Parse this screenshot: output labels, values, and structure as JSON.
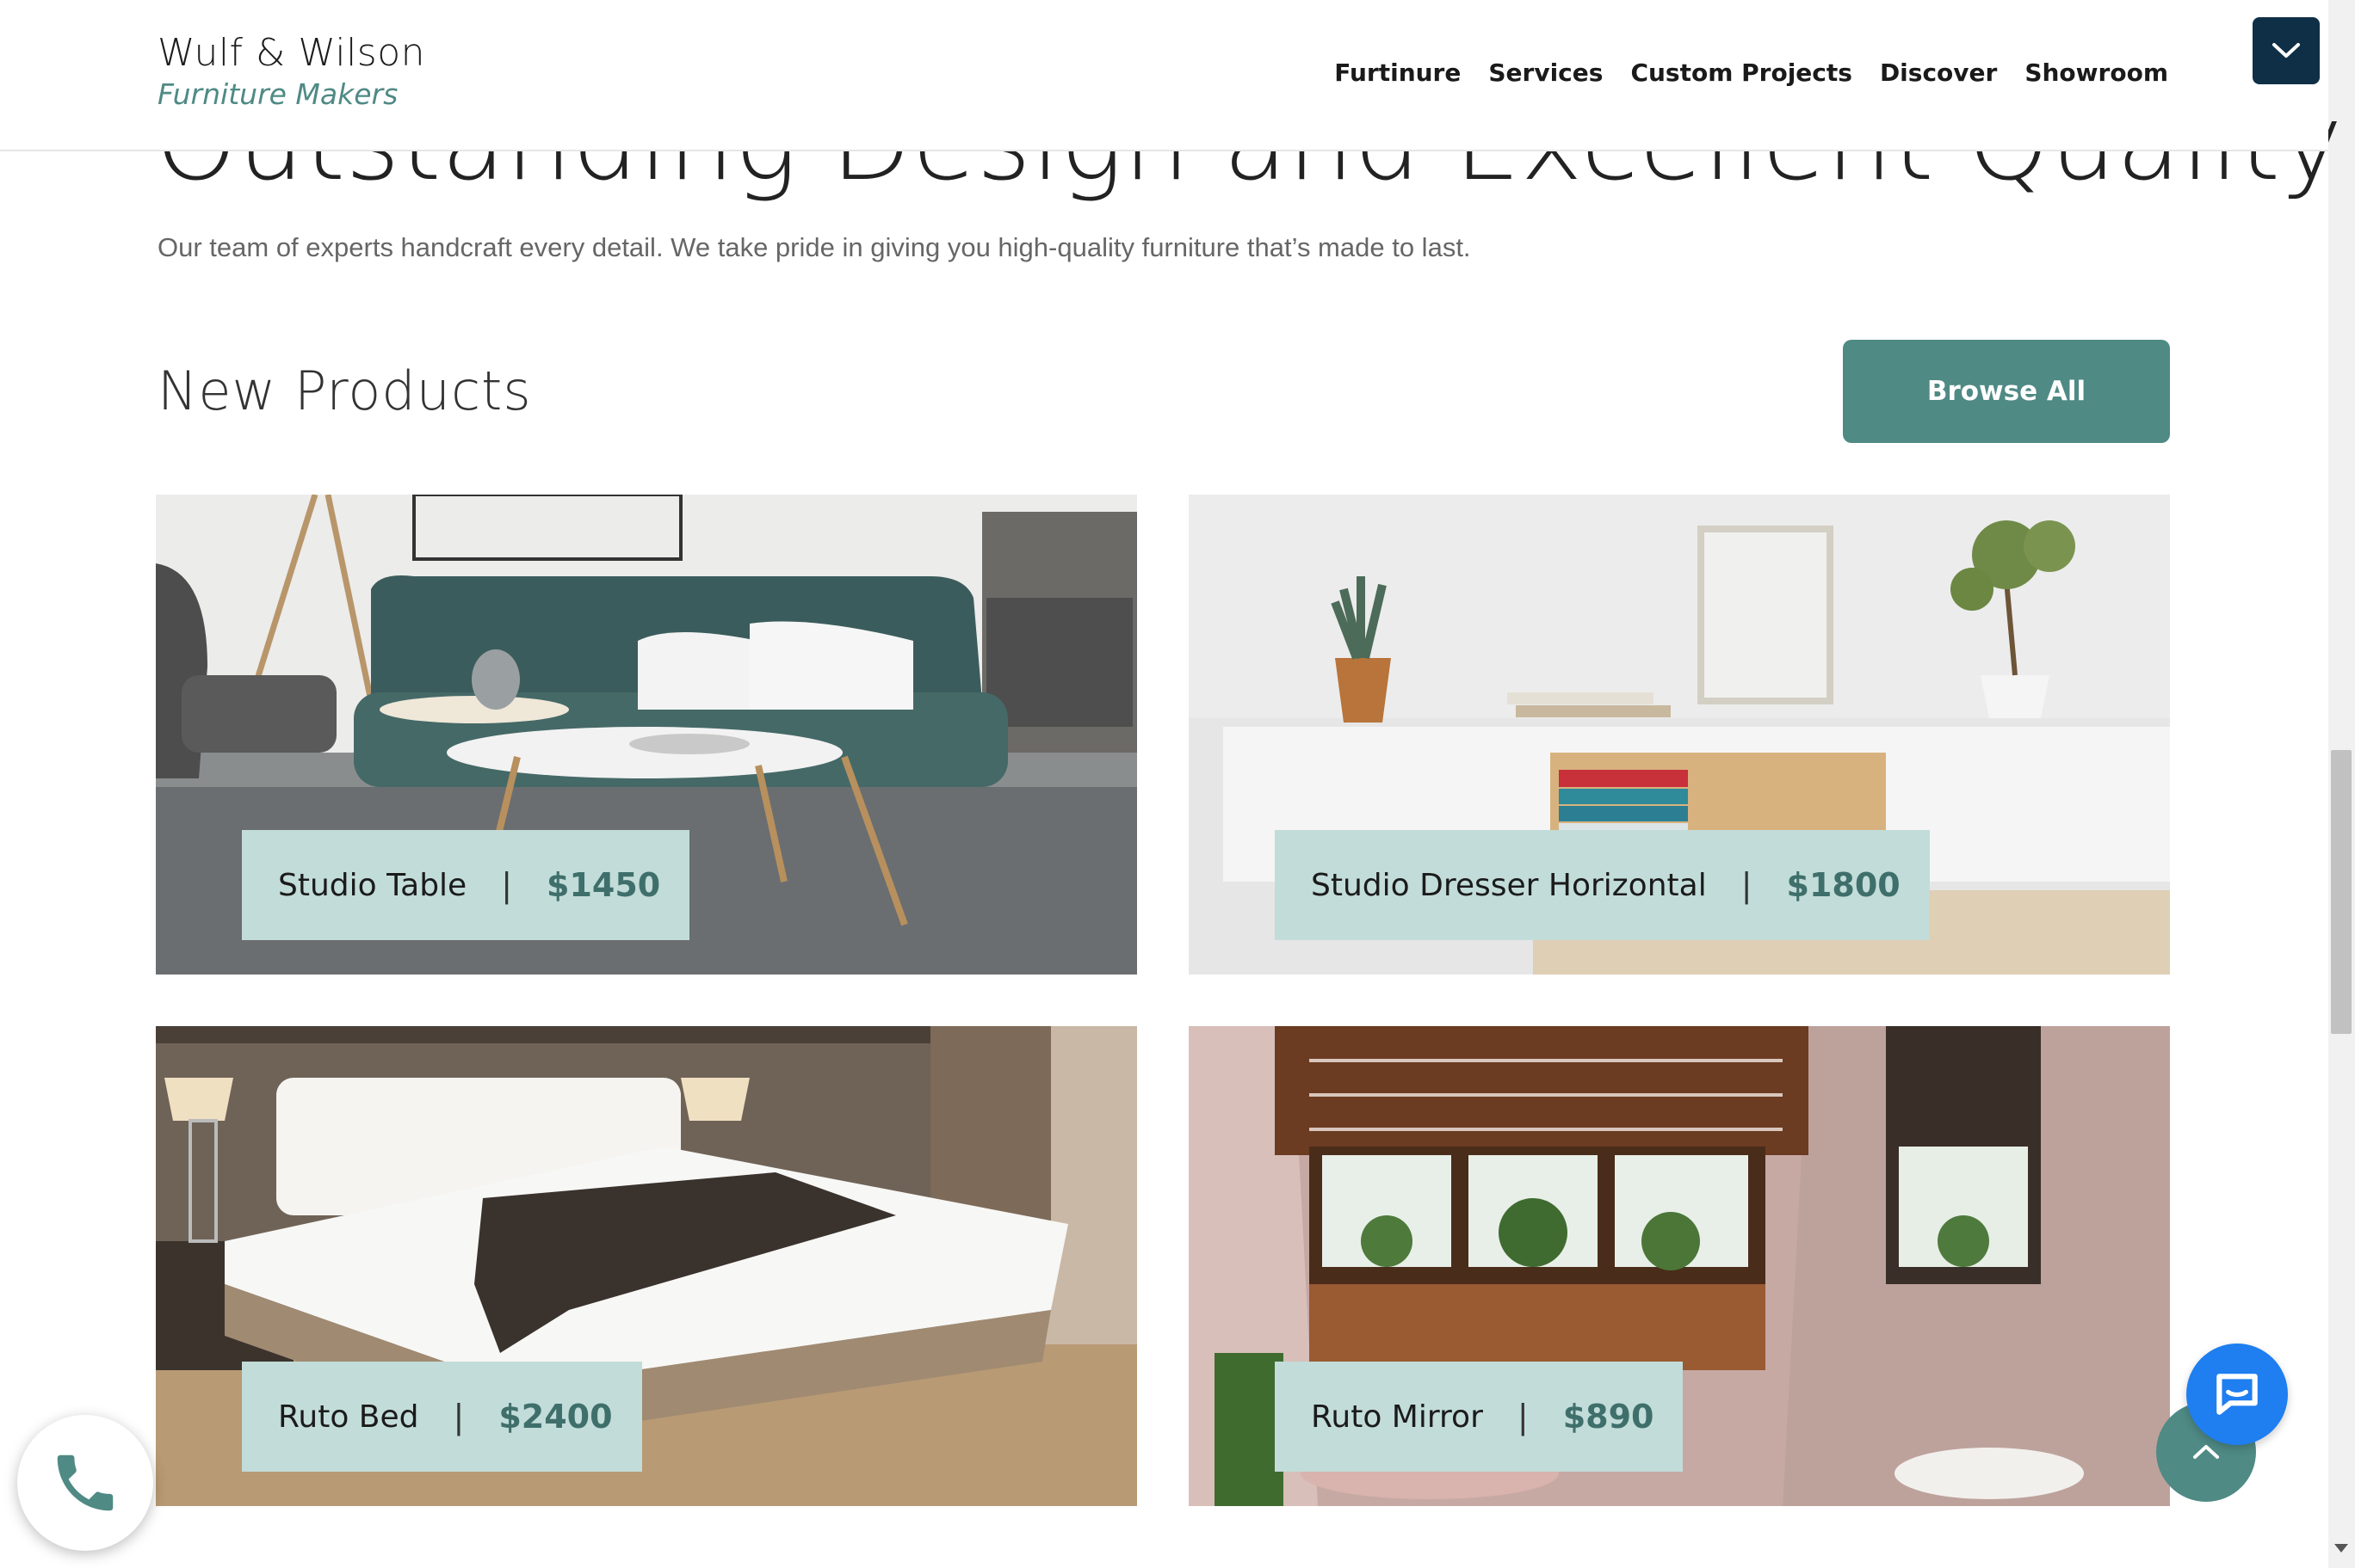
{
  "header": {
    "brand_title": "Wulf & Wilson",
    "brand_subtitle": "Furniture Makers",
    "nav": [
      "Furtinure",
      "Services",
      "Custom Projects",
      "Discover",
      "Showroom"
    ],
    "menu_toggle_icon": "chevron-down-icon"
  },
  "hero": {
    "heading": "Outstanding Design and Excellent Quality",
    "intro": "Our team of experts handcraft every detail. We take pride in giving you high-quality furniture that’s made to last."
  },
  "section": {
    "title": "New Products",
    "browse_label": "Browse All"
  },
  "products": [
    {
      "name": "Studio Table",
      "separator": "|",
      "price": "$1450"
    },
    {
      "name": "Studio Dresser Horizontal",
      "separator": "|",
      "price": "$1800"
    },
    {
      "name": "Ruto Bed",
      "separator": "|",
      "price": "$2400"
    },
    {
      "name": "Ruto Mirror",
      "separator": "|",
      "price": "$890"
    }
  ],
  "floating": {
    "phone_icon": "phone-icon",
    "chat_icon": "chat-icon",
    "top_icon": "chevron-up-icon"
  },
  "colors": {
    "accent": "#4f8a85",
    "label_bg": "#c2dcd9",
    "menu_bg": "#0f2f46",
    "chat_blue": "#1f7ef0"
  }
}
